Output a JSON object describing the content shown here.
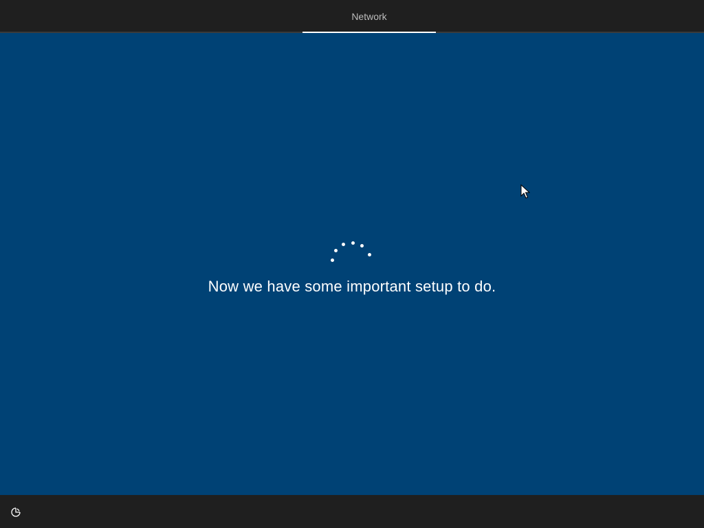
{
  "header": {
    "tabs": [
      {
        "label": "Network",
        "active": true
      }
    ]
  },
  "main": {
    "status_message": "Now we have some important setup to do.",
    "spinner_icon": "loading-dots-icon"
  },
  "footer": {
    "ease_of_access_icon": "ease-of-access-icon"
  },
  "colors": {
    "background": "#004275",
    "bar": "#1f1f1f",
    "text": "#ffffff",
    "tab_text": "#bdbdbd"
  }
}
